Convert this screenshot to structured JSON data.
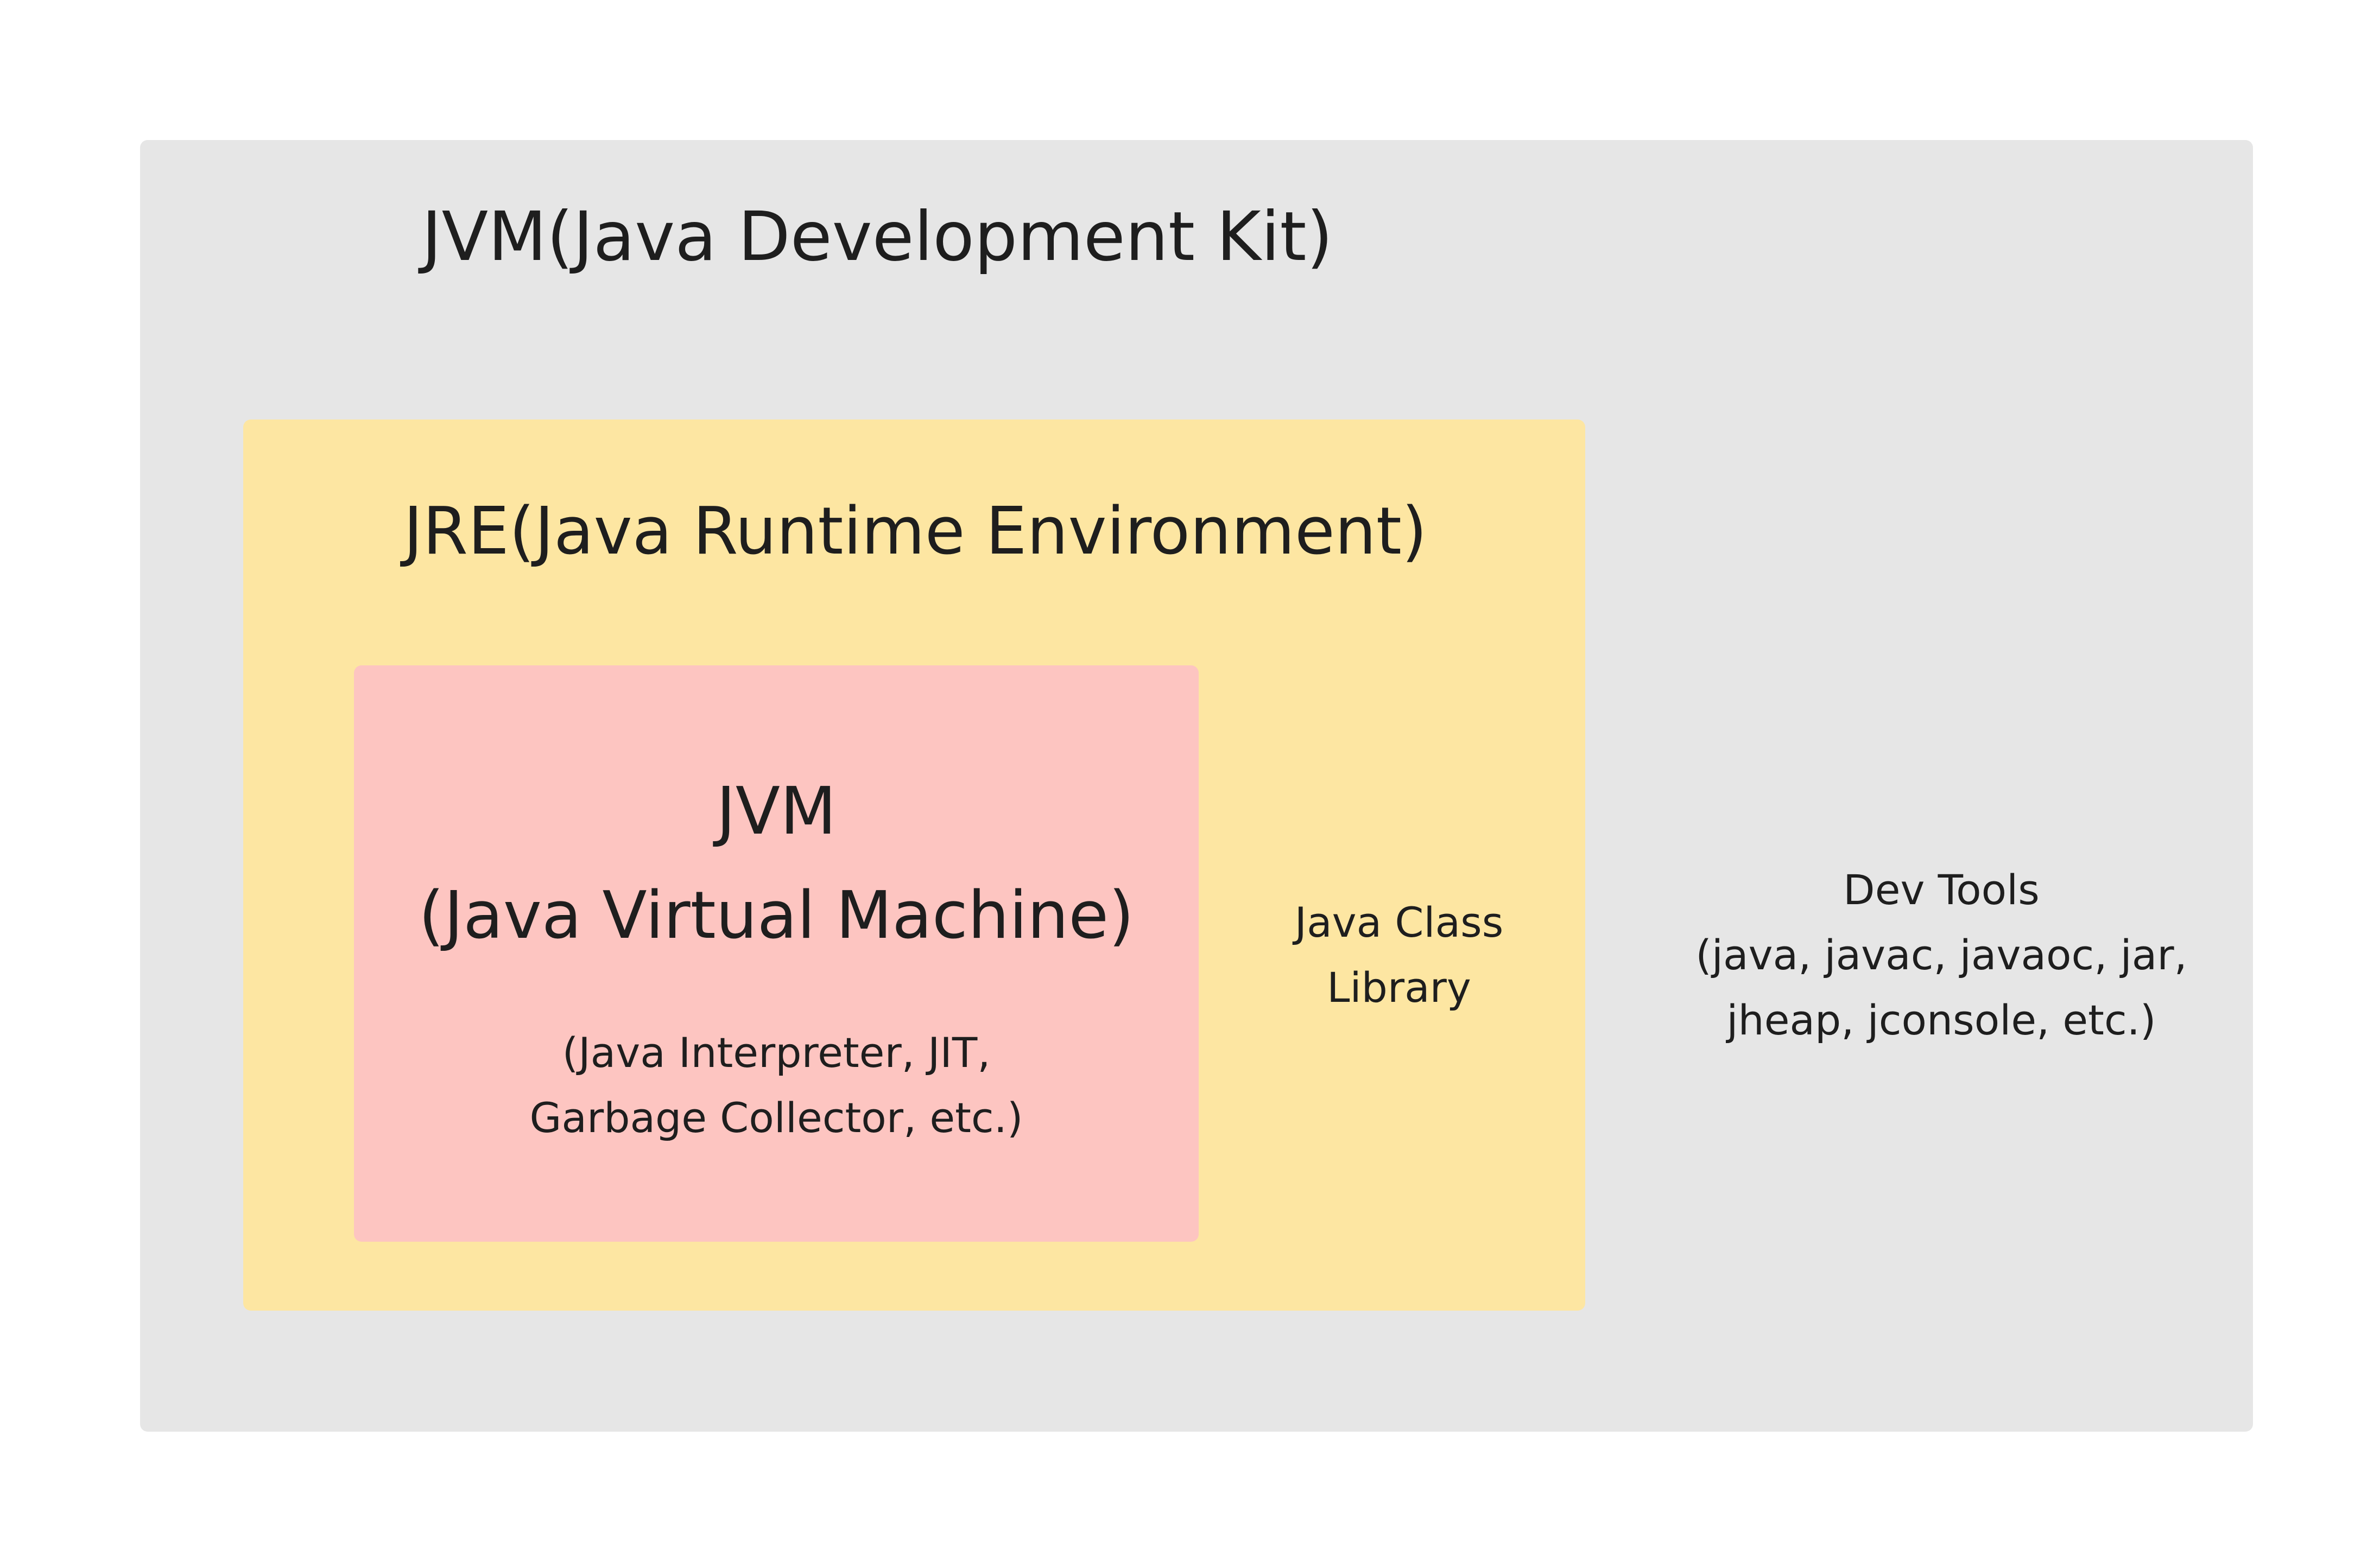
{
  "diagram": {
    "jdk": {
      "title": "JVM(Java Development Kit)",
      "color": "#e6e6e6"
    },
    "jre": {
      "title": "JRE(Java Runtime Environment)",
      "color": "#fde6a2"
    },
    "jvm": {
      "title": "JVM\n(Java Virtual Machine)",
      "components": "(Java Interpreter, JIT,\nGarbage Collector, etc.)",
      "color": "#fdc5c1"
    },
    "class_library": {
      "label": "Java Class\nLibrary"
    },
    "dev_tools": {
      "label": "Dev Tools\n(java, javac, javaoc, jar,\njheap, jconsole, etc.)"
    }
  }
}
